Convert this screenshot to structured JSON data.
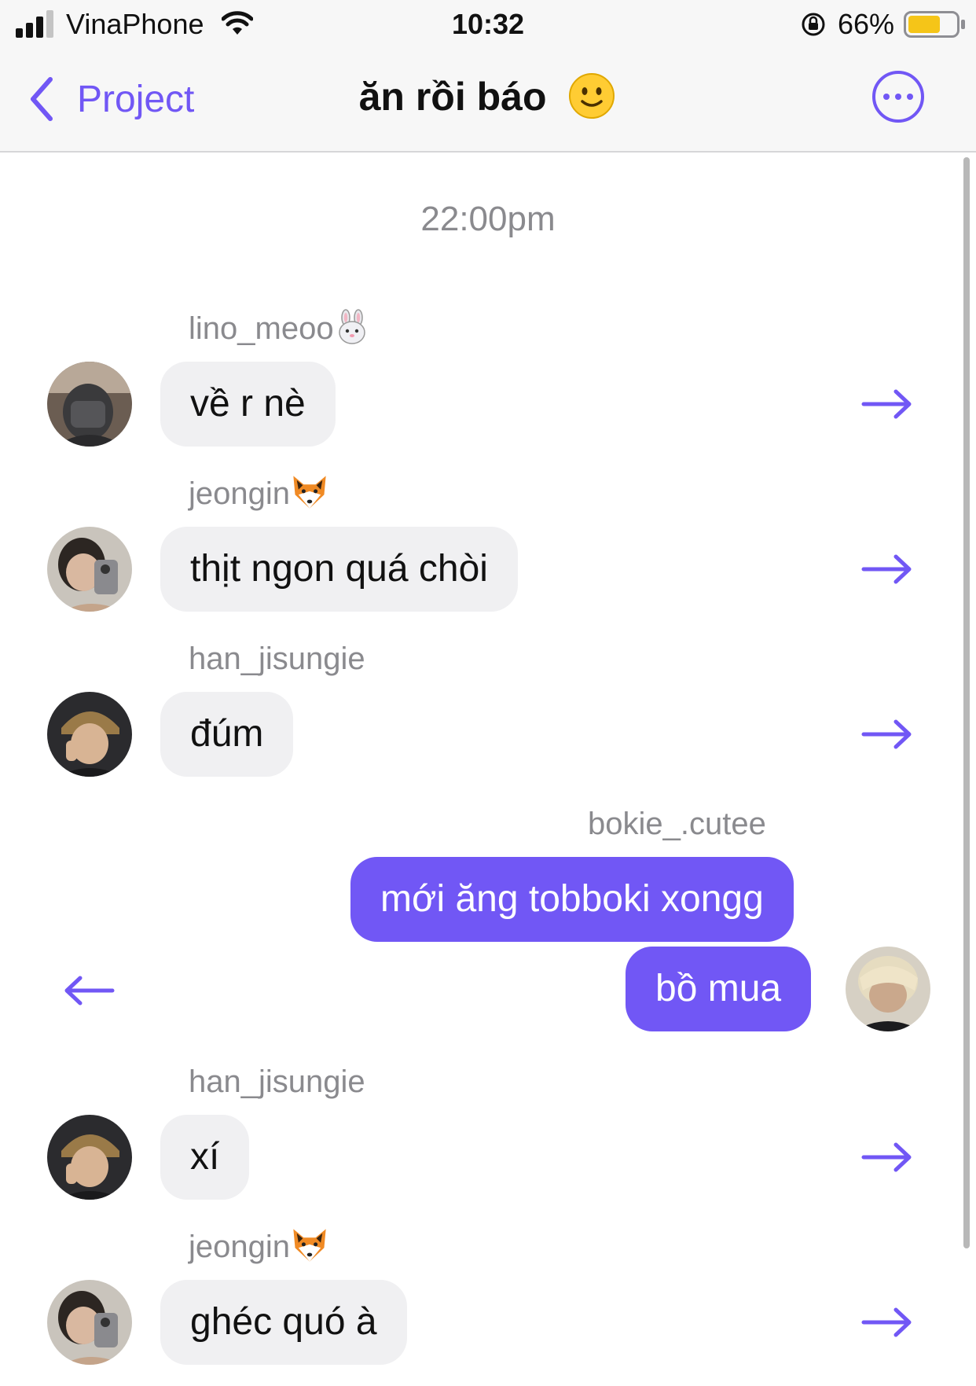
{
  "status_bar": {
    "carrier": "VinaPhone",
    "time": "10:32",
    "battery_percent": "66%",
    "battery_level": 0.66,
    "battery_color": "#f5c518"
  },
  "nav": {
    "back_label": "Project",
    "title": "ăn rồi báo",
    "title_emoji": "slightly-smiling-face-icon",
    "more_icon": "more-horizontal-circle-icon",
    "accent_color": "#7157f5"
  },
  "timestamp": "22:00pm",
  "messages": [
    {
      "sender": "lino_meoo",
      "sender_emoji": "rabbit-face-icon",
      "text": "về r nè",
      "direction": "incoming",
      "action_icon": "arrow-right-icon"
    },
    {
      "sender": "jeongin",
      "sender_emoji": "fox-face-icon",
      "text": "thịt ngon quá chòi",
      "direction": "incoming",
      "action_icon": "arrow-right-icon"
    },
    {
      "sender": "han_jisungie",
      "text": "đúm",
      "direction": "incoming",
      "action_icon": "arrow-right-icon"
    },
    {
      "sender": "bokie_.cutee",
      "text": "mới ăng tobboki xongg",
      "direction": "outgoing"
    },
    {
      "text": "bồ mua",
      "direction": "outgoing",
      "action_icon": "arrow-left-icon"
    },
    {
      "sender": "han_jisungie",
      "text": "xí",
      "direction": "incoming",
      "action_icon": "arrow-right-icon"
    },
    {
      "sender": "jeongin",
      "sender_emoji": "fox-face-icon",
      "text": "ghéc quó à",
      "direction": "incoming",
      "action_icon": "arrow-right-icon"
    }
  ]
}
